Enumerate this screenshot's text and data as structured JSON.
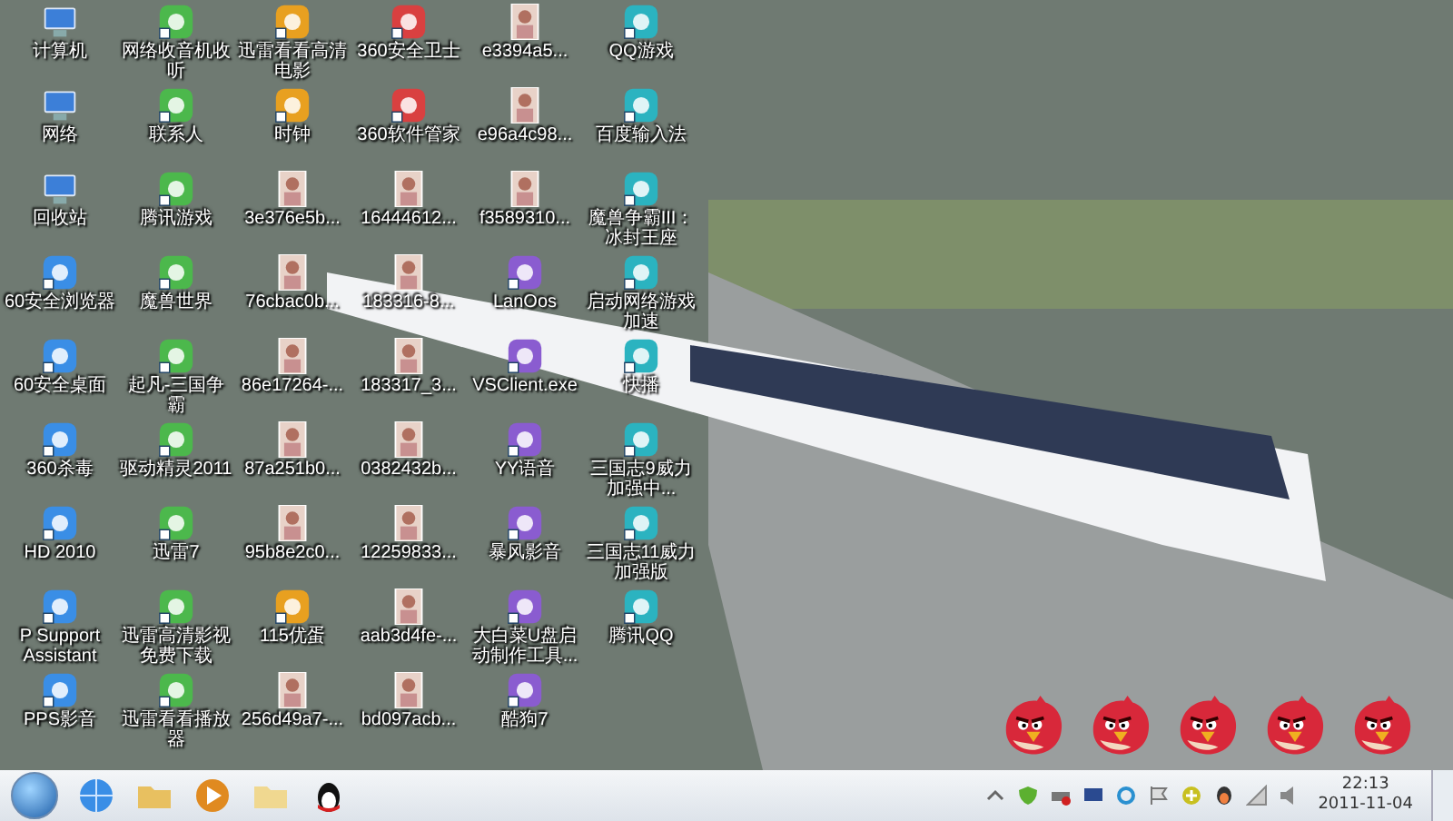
{
  "desktop": {
    "icons": [
      {
        "label": "计算机",
        "kind": "system"
      },
      {
        "label": "网络收音机收听",
        "kind": "app"
      },
      {
        "label": "迅雷看看高清电影",
        "kind": "app"
      },
      {
        "label": "360安全卫士",
        "kind": "app"
      },
      {
        "label": "e3394a5...",
        "kind": "image"
      },
      {
        "label": "QQ游戏",
        "kind": "app"
      },
      {
        "label": "网络",
        "kind": "system"
      },
      {
        "label": "联系人",
        "kind": "app"
      },
      {
        "label": "时钟",
        "kind": "app"
      },
      {
        "label": "360软件管家",
        "kind": "app"
      },
      {
        "label": "e96a4c98...",
        "kind": "image"
      },
      {
        "label": "百度输入法",
        "kind": "app"
      },
      {
        "label": "回收站",
        "kind": "system"
      },
      {
        "label": "腾讯游戏",
        "kind": "app"
      },
      {
        "label": "3e376e5b...",
        "kind": "image"
      },
      {
        "label": "16444612...",
        "kind": "image"
      },
      {
        "label": "f3589310...",
        "kind": "image"
      },
      {
        "label": "魔兽争霸III：冰封王座",
        "kind": "app"
      },
      {
        "label": "60安全浏览器",
        "kind": "app"
      },
      {
        "label": "魔兽世界",
        "kind": "app"
      },
      {
        "label": "76cbac0b...",
        "kind": "image"
      },
      {
        "label": "183316-8...",
        "kind": "image"
      },
      {
        "label": "LanOos",
        "kind": "app"
      },
      {
        "label": "启动网络游戏加速",
        "kind": "app"
      },
      {
        "label": "60安全桌面",
        "kind": "app"
      },
      {
        "label": "起凡-三国争霸",
        "kind": "app"
      },
      {
        "label": "86e17264-...",
        "kind": "image"
      },
      {
        "label": "183317_3...",
        "kind": "image"
      },
      {
        "label": "VSClient.exe",
        "kind": "app"
      },
      {
        "label": "快播",
        "kind": "app"
      },
      {
        "label": "360杀毒",
        "kind": "app"
      },
      {
        "label": "驱动精灵2011",
        "kind": "app"
      },
      {
        "label": "87a251b0...",
        "kind": "image"
      },
      {
        "label": "0382432b...",
        "kind": "image"
      },
      {
        "label": "YY语音",
        "kind": "app"
      },
      {
        "label": "三国志9威力加强中...",
        "kind": "app"
      },
      {
        "label": "HD 2010",
        "kind": "app"
      },
      {
        "label": "迅雷7",
        "kind": "app"
      },
      {
        "label": "95b8e2c0...",
        "kind": "image"
      },
      {
        "label": "12259833...",
        "kind": "image"
      },
      {
        "label": "暴风影音",
        "kind": "app"
      },
      {
        "label": "三国志11威力加强版",
        "kind": "app"
      },
      {
        "label": "P Support Assistant",
        "kind": "app"
      },
      {
        "label": "迅雷高清影视免费下载",
        "kind": "app"
      },
      {
        "label": "115优蛋",
        "kind": "app"
      },
      {
        "label": "aab3d4fe-...",
        "kind": "image"
      },
      {
        "label": "大白菜U盘启动制作工具...",
        "kind": "app"
      },
      {
        "label": "腾讯QQ",
        "kind": "app"
      },
      {
        "label": "PPS影音",
        "kind": "app"
      },
      {
        "label": "迅雷看看播放器",
        "kind": "app"
      },
      {
        "label": "256d49a7-...",
        "kind": "image"
      },
      {
        "label": "bd097acb...",
        "kind": "image"
      },
      {
        "label": "酷狗7",
        "kind": "app"
      }
    ]
  },
  "taskbar": {
    "clock": {
      "time": "22:13",
      "date": "2011-11-04"
    }
  }
}
